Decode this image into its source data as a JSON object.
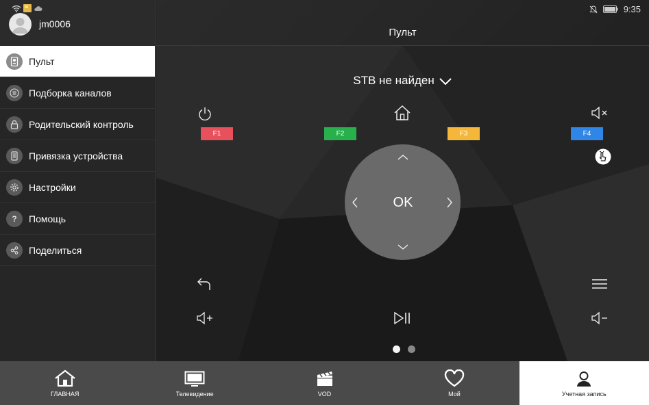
{
  "sidebar": {
    "username": "jm0006",
    "items": [
      {
        "label": "Пульт",
        "icon": "remote-icon",
        "active": true
      },
      {
        "label": "Подборка каналов",
        "icon": "list-icon",
        "active": false
      },
      {
        "label": "Родительский контроль",
        "icon": "lock-icon",
        "active": false
      },
      {
        "label": "Привязка устройства",
        "icon": "device-icon",
        "active": false
      },
      {
        "label": "Настройки",
        "icon": "gear-icon",
        "active": false
      },
      {
        "label": "Помощь",
        "icon": "help-icon",
        "active": false
      },
      {
        "label": "Поделиться",
        "icon": "share-icon",
        "active": false
      }
    ]
  },
  "statusbar": {
    "time": "9:35"
  },
  "header": {
    "title": "Пульт"
  },
  "remote": {
    "device_label": "STB не найден",
    "ok_label": "OK",
    "fkeys": [
      {
        "label": "F1",
        "color": "#e8505b"
      },
      {
        "label": "F2",
        "color": "#27b04b"
      },
      {
        "label": "F3",
        "color": "#f4b73a"
      },
      {
        "label": "F4",
        "color": "#2f86e6"
      }
    ],
    "page_count": 2,
    "current_page": 1
  },
  "bottomnav": {
    "tabs": [
      {
        "label": "ГЛАВНАЯ",
        "icon": "home-icon",
        "active": false
      },
      {
        "label": "Телевидение",
        "icon": "tv-icon",
        "active": false
      },
      {
        "label": "VOD",
        "icon": "clapperboard-icon",
        "active": false
      },
      {
        "label": "Мой",
        "icon": "heart-icon",
        "active": false
      },
      {
        "label": "Учетная запись",
        "icon": "account-icon",
        "active": true
      }
    ]
  }
}
